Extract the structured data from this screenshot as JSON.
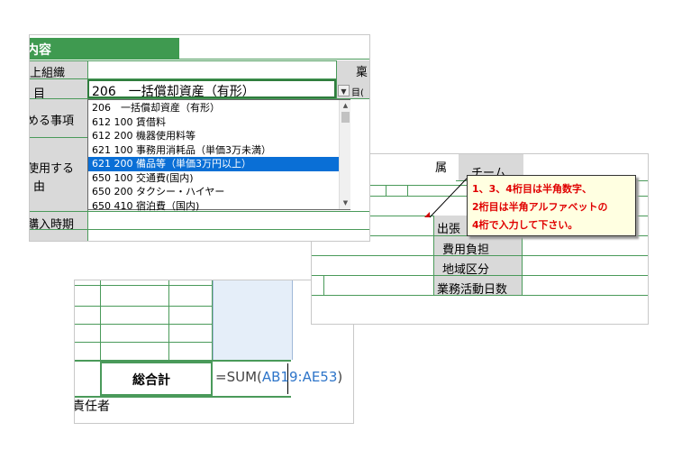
{
  "panel_a": {
    "header": "内容",
    "row_labels": [
      "上組織",
      "目",
      "める事項",
      "使用する",
      "由",
      "購入時期"
    ],
    "right_label": "稟",
    "right_small": "目(",
    "selected_value": "206　一括償却資産（有形）",
    "dropdown_items": [
      "206　一括償却資産（有形）",
      "612 100 賃借料",
      "612 200 機器使用料等",
      "621 100 事務用消耗品（単価3万未満）",
      "621 200 備品等（単価3万円以上）",
      "650 100 交通費(国内)",
      "650 200 タクシー・ハイヤー",
      "650 410 宿泊費（国内)"
    ],
    "selected_index": 4
  },
  "panel_b": {
    "top_labels": [
      "属",
      "チーム"
    ],
    "row_labels": [
      "出張",
      "費用負担",
      "地域区分",
      "業務活動日数"
    ],
    "comment_lines": [
      "1、3、4桁目は半角数字、",
      "2桁目は半角アルファベットの",
      "4桁で入力して下さい。"
    ]
  },
  "panel_c": {
    "total_label": "総合計",
    "formula_prefix": "=SUM(",
    "formula_ref": "AB19:AE53",
    "formula_suffix": ")",
    "footer_label": "責任者"
  },
  "colors": {
    "green": "#4a9a5a",
    "select_blue": "#0a6fd6",
    "comment_bg": "#ffffe1",
    "comment_text": "#e00000",
    "ref_blue": "#2e75c9"
  },
  "icons": [
    "dropdown-arrow-icon",
    "scroll-up-icon",
    "scroll-down-icon",
    "comment-indicator-icon"
  ]
}
